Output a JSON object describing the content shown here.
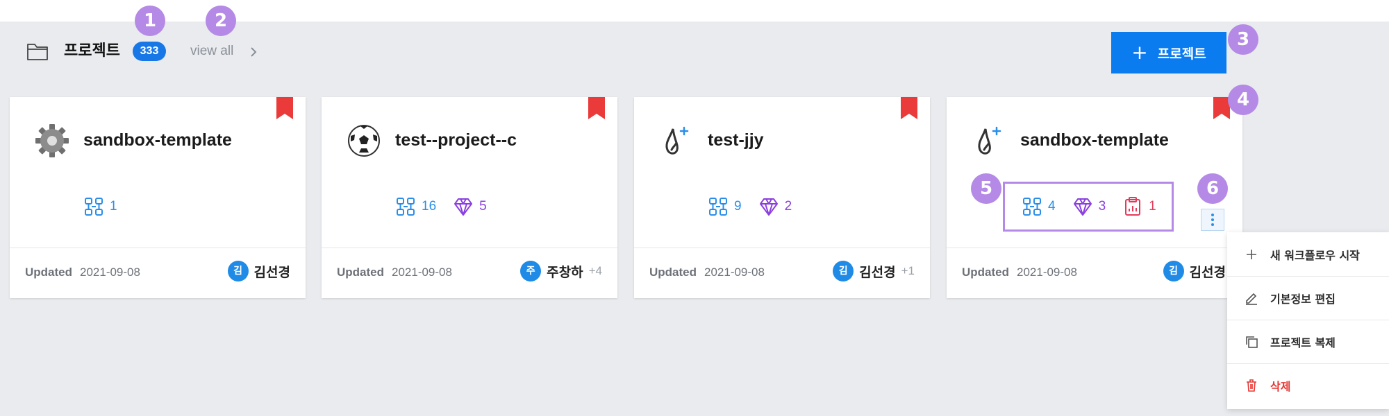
{
  "header": {
    "title": "프로젝트",
    "count": "333",
    "view_all": "view all",
    "new_button_label": "프로젝트"
  },
  "cards": [
    {
      "name": "sandbox-template",
      "icon": "gear-icon",
      "workflows": "1",
      "updated_label": "Updated",
      "updated_date": "2021-09-08",
      "owner_initial": "김",
      "owner_name": "김선경",
      "owner_extra": ""
    },
    {
      "name": "test--project--c",
      "icon": "soccer-ball-icon",
      "workflows": "16",
      "models": "5",
      "updated_label": "Updated",
      "updated_date": "2021-09-08",
      "owner_initial": "주",
      "owner_name": "주창하",
      "owner_extra": "+4"
    },
    {
      "name": "test-jjy",
      "icon": "drop-sparkle-icon",
      "workflows": "9",
      "models": "2",
      "updated_label": "Updated",
      "updated_date": "2021-09-08",
      "owner_initial": "김",
      "owner_name": "김선경",
      "owner_extra": "+1"
    },
    {
      "name": "sandbox-template",
      "icon": "drop-sparkle-icon",
      "workflows": "4",
      "models": "3",
      "reports": "1",
      "updated_label": "Updated",
      "updated_date": "2021-09-08",
      "owner_initial": "김",
      "owner_name": "김선경",
      "owner_extra": ""
    }
  ],
  "menu": [
    {
      "label": "새 워크플로우 시작",
      "icon": "plus-icon"
    },
    {
      "label": "기본정보 편집",
      "icon": "pencil-icon"
    },
    {
      "label": "프로젝트 복제",
      "icon": "copy-icon"
    },
    {
      "label": "삭제",
      "icon": "trash-icon"
    }
  ],
  "markers": [
    "1",
    "2",
    "3",
    "4",
    "5",
    "6"
  ],
  "colors": {
    "accent": "#0b7cf0",
    "bookmark": "#ea3a3a",
    "marker": "#b589e6",
    "workflow": "#2a8ee8",
    "model": "#8b3fe0",
    "report": "#e53a5a",
    "danger": "#e53935"
  }
}
